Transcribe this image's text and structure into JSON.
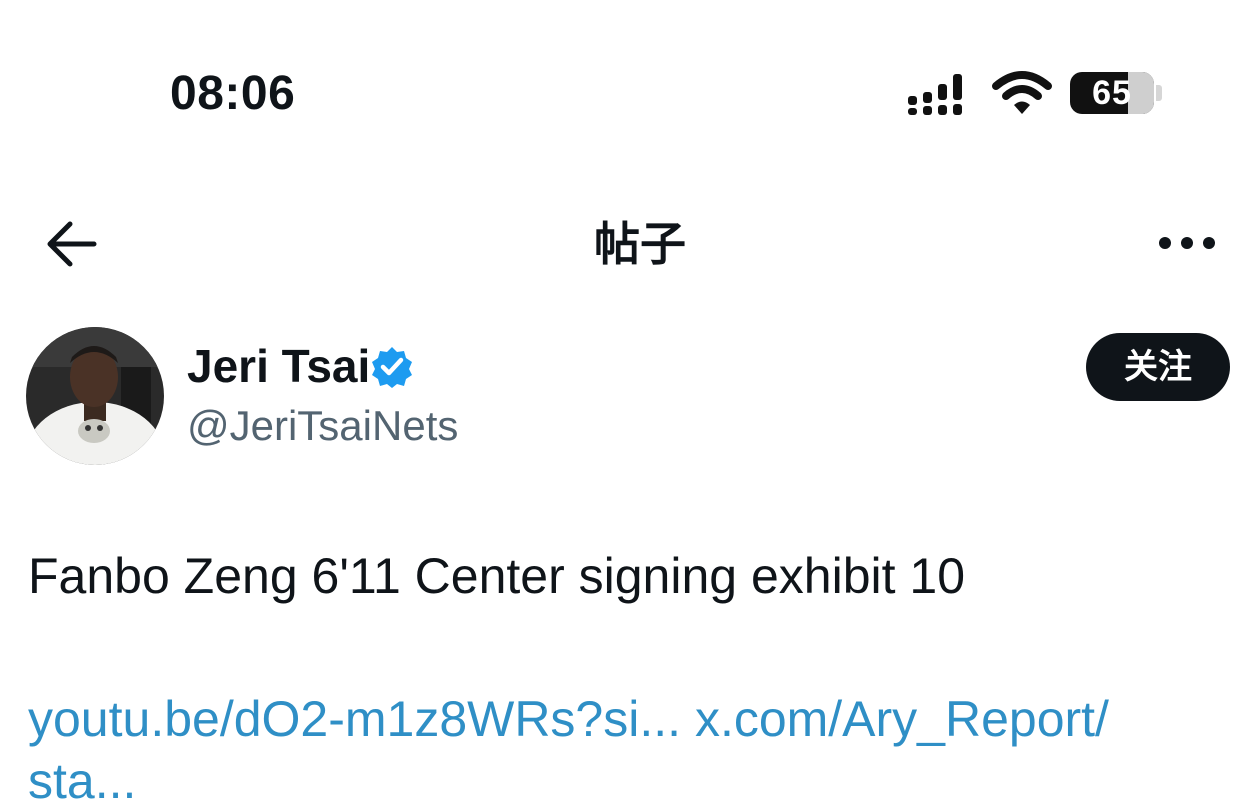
{
  "status_bar": {
    "time": "08:06",
    "battery_level": "65",
    "icons": [
      "signal-icon",
      "wifi-icon",
      "battery-icon"
    ]
  },
  "header": {
    "title": "帖子",
    "back_icon": "arrow-left-icon",
    "more_icon": "more-horizontal-icon"
  },
  "author": {
    "display_name": "Jeri Tsai",
    "handle": "@JeriTsaiNets",
    "verified": true,
    "verified_color": "#1d9bf0",
    "follow_label": "关注"
  },
  "post": {
    "text": "Fanbo Zeng 6'11 Center signing exhibit 10",
    "link_1": "youtu.be/dO2-m1z8WRs?si...",
    "link_2": "x.com/Ary_Report/",
    "link_2_cont": "sta..."
  },
  "colors": {
    "text": "#0f1419",
    "secondary": "#536471",
    "link": "#2f8fc6",
    "button_bg": "#0f1419"
  }
}
